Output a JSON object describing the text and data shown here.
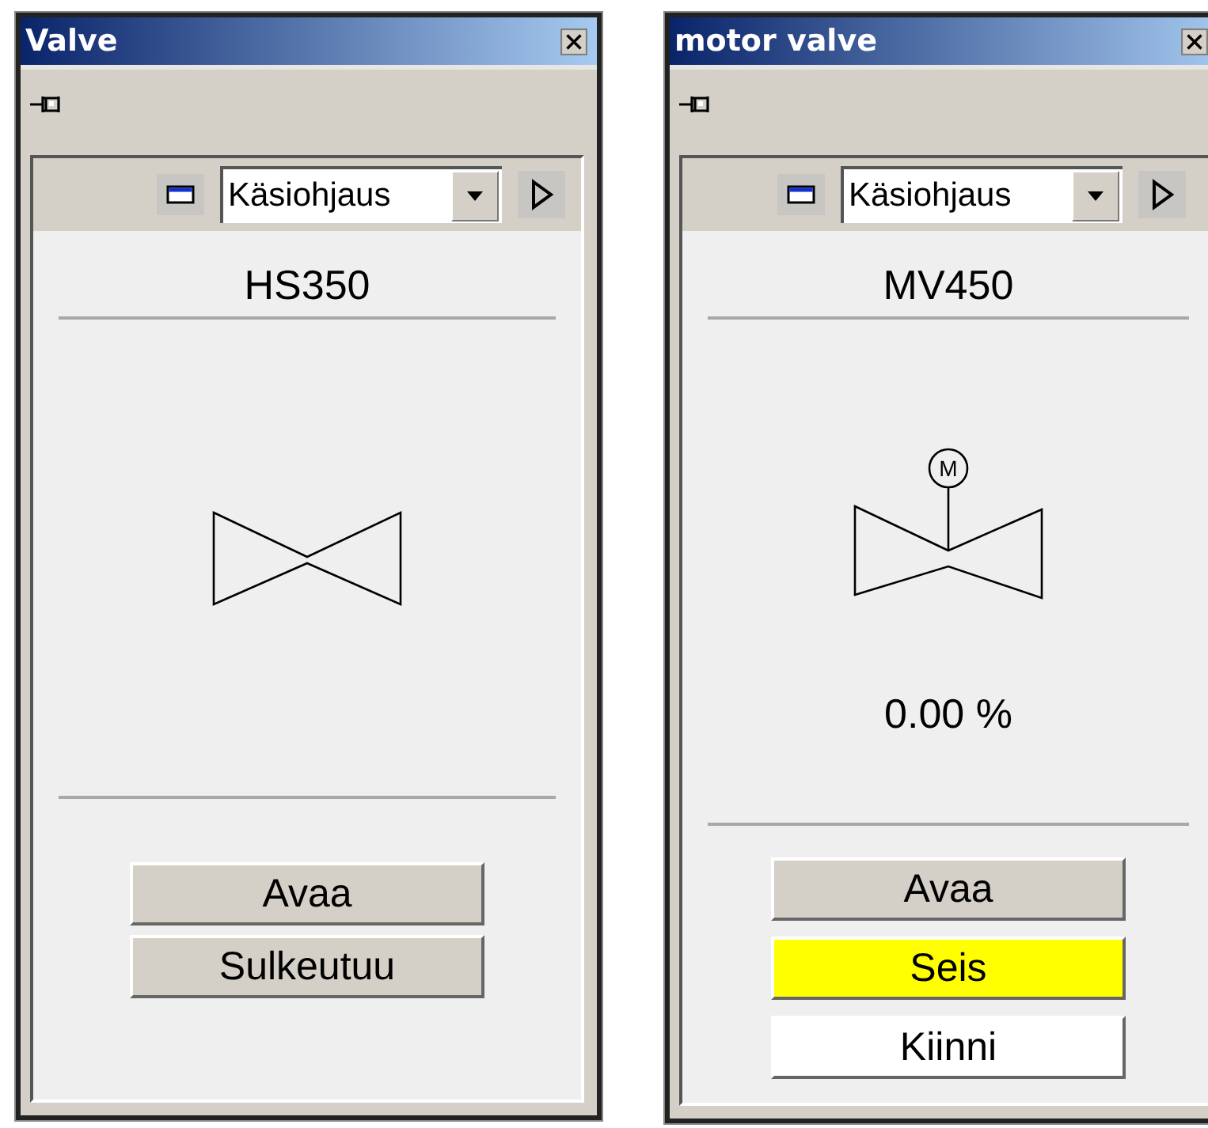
{
  "windows": [
    {
      "title": "Valve",
      "kind": "manual",
      "mode": "Käsiohjaus",
      "tag": "HS350",
      "buttons": [
        {
          "label": "Avaa",
          "color": "#d4d0c8"
        },
        {
          "label": "Sulkeutuu",
          "color": "#d4d0c8"
        }
      ]
    },
    {
      "title": "motor valve",
      "kind": "motor",
      "motor_label": "M",
      "mode": "Käsiohjaus",
      "tag": "MV450",
      "reading": "0.00 %",
      "buttons": [
        {
          "label": "Avaa",
          "color": "#d4d0c8"
        },
        {
          "label": "Seis",
          "color": "#ffff00"
        },
        {
          "label": "Kiinni",
          "color": "#ffffff"
        }
      ]
    }
  ]
}
